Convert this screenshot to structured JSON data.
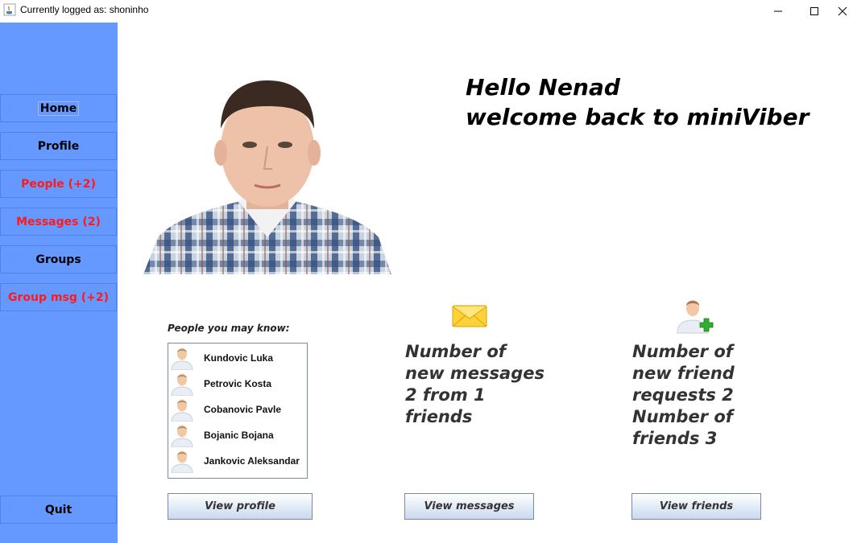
{
  "window": {
    "title": "Currently logged as: shoninho",
    "app_icon": "java-icon",
    "controls": [
      "minimize-icon",
      "maximize-icon",
      "close-icon"
    ]
  },
  "sidebar": {
    "items": [
      {
        "label": "Home",
        "alert": false
      },
      {
        "label": "Profile",
        "alert": false
      },
      {
        "label": "People (+2)",
        "alert": true
      },
      {
        "label": "Messages (2)",
        "alert": true
      },
      {
        "label": "Groups",
        "alert": false
      },
      {
        "label": "Group msg (+2)",
        "alert": true
      }
    ],
    "quit_label": "Quit",
    "bg_color": "#6699ff",
    "alert_color": "#ff1a1a"
  },
  "greeting": {
    "line1": "Hello Nenad",
    "line2": "welcome back to miniViber"
  },
  "people_you_may_know": {
    "label": "People you may know:",
    "people": [
      "Kundovic Luka",
      "Petrovic Kosta",
      "Cobanovic Pavle",
      "Bojanic Bojana",
      "Jankovic Aleksandar"
    ],
    "button_label": "View profile"
  },
  "messages_panel": {
    "icon": "envelope-icon",
    "text": "Number of\nnew messages\n2 from 1\nfriends",
    "button_label": "View messages"
  },
  "friends_panel": {
    "icon": "add-friend-icon",
    "text": "Number of\nnew friend\nrequests 2\nNumber of\nfriends 3",
    "button_label": "View friends"
  }
}
